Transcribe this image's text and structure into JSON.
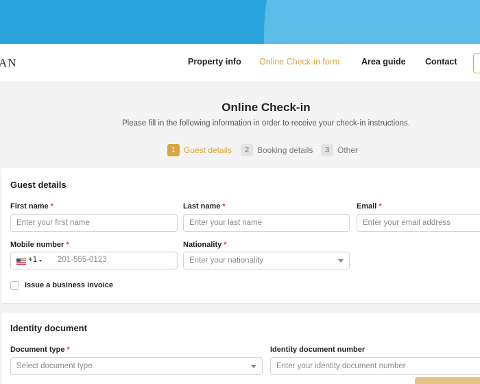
{
  "brand": {
    "logo_text": "AN"
  },
  "nav": {
    "links": [
      {
        "label": "Property info",
        "active": false
      },
      {
        "label": "Online Check-in form",
        "active": true
      },
      {
        "label": "Area guide",
        "active": false
      },
      {
        "label": "Contact",
        "active": false
      }
    ]
  },
  "page": {
    "title": "Online Check-in",
    "subtitle": "Please fill in the following information in order to receive your check-in instructions."
  },
  "steps": [
    {
      "number": "1",
      "label": "Guest details",
      "active": true
    },
    {
      "number": "2",
      "label": "Booking details",
      "active": false
    },
    {
      "number": "3",
      "label": "Other",
      "active": false
    }
  ],
  "guest_details": {
    "title": "Guest details",
    "required_mark": "*",
    "first_name": {
      "label": "First name",
      "placeholder": "Enter your first name",
      "value": ""
    },
    "last_name": {
      "label": "Last name",
      "placeholder": "Enter your last name",
      "value": ""
    },
    "email": {
      "label": "Email",
      "placeholder": "Enter your email address",
      "value": ""
    },
    "mobile": {
      "label": "Mobile number",
      "country_code": "+1",
      "placeholder": "201-555-0123",
      "value": ""
    },
    "nationality": {
      "label": "Nationality",
      "placeholder": "Enter your nationality",
      "value": ""
    },
    "business_invoice": {
      "label": "Issue a business invoice",
      "checked": false
    }
  },
  "identity_document": {
    "title": "Identity document",
    "document_type": {
      "label": "Document type",
      "placeholder": "Select document type",
      "value": ""
    },
    "document_number": {
      "label": "Identity document number",
      "placeholder": "Enter your identity document number",
      "value": ""
    }
  },
  "colors": {
    "accent": "#d8a640",
    "hero_blue": "#29a3dc",
    "hero_blue_light": "#5bbde8",
    "required": "#e0433b",
    "background": "#f4f4f4"
  }
}
